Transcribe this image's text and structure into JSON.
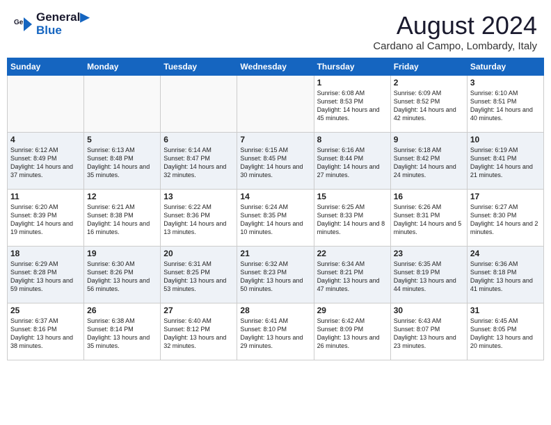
{
  "header": {
    "logo_line1": "General",
    "logo_line2": "Blue",
    "month_year": "August 2024",
    "location": "Cardano al Campo, Lombardy, Italy"
  },
  "weekdays": [
    "Sunday",
    "Monday",
    "Tuesday",
    "Wednesday",
    "Thursday",
    "Friday",
    "Saturday"
  ],
  "weeks": [
    [
      {
        "day": "",
        "content": ""
      },
      {
        "day": "",
        "content": ""
      },
      {
        "day": "",
        "content": ""
      },
      {
        "day": "",
        "content": ""
      },
      {
        "day": "1",
        "content": "Sunrise: 6:08 AM\nSunset: 8:53 PM\nDaylight: 14 hours and 45 minutes."
      },
      {
        "day": "2",
        "content": "Sunrise: 6:09 AM\nSunset: 8:52 PM\nDaylight: 14 hours and 42 minutes."
      },
      {
        "day": "3",
        "content": "Sunrise: 6:10 AM\nSunset: 8:51 PM\nDaylight: 14 hours and 40 minutes."
      }
    ],
    [
      {
        "day": "4",
        "content": "Sunrise: 6:12 AM\nSunset: 8:49 PM\nDaylight: 14 hours and 37 minutes."
      },
      {
        "day": "5",
        "content": "Sunrise: 6:13 AM\nSunset: 8:48 PM\nDaylight: 14 hours and 35 minutes."
      },
      {
        "day": "6",
        "content": "Sunrise: 6:14 AM\nSunset: 8:47 PM\nDaylight: 14 hours and 32 minutes."
      },
      {
        "day": "7",
        "content": "Sunrise: 6:15 AM\nSunset: 8:45 PM\nDaylight: 14 hours and 30 minutes."
      },
      {
        "day": "8",
        "content": "Sunrise: 6:16 AM\nSunset: 8:44 PM\nDaylight: 14 hours and 27 minutes."
      },
      {
        "day": "9",
        "content": "Sunrise: 6:18 AM\nSunset: 8:42 PM\nDaylight: 14 hours and 24 minutes."
      },
      {
        "day": "10",
        "content": "Sunrise: 6:19 AM\nSunset: 8:41 PM\nDaylight: 14 hours and 21 minutes."
      }
    ],
    [
      {
        "day": "11",
        "content": "Sunrise: 6:20 AM\nSunset: 8:39 PM\nDaylight: 14 hours and 19 minutes."
      },
      {
        "day": "12",
        "content": "Sunrise: 6:21 AM\nSunset: 8:38 PM\nDaylight: 14 hours and 16 minutes."
      },
      {
        "day": "13",
        "content": "Sunrise: 6:22 AM\nSunset: 8:36 PM\nDaylight: 14 hours and 13 minutes."
      },
      {
        "day": "14",
        "content": "Sunrise: 6:24 AM\nSunset: 8:35 PM\nDaylight: 14 hours and 10 minutes."
      },
      {
        "day": "15",
        "content": "Sunrise: 6:25 AM\nSunset: 8:33 PM\nDaylight: 14 hours and 8 minutes."
      },
      {
        "day": "16",
        "content": "Sunrise: 6:26 AM\nSunset: 8:31 PM\nDaylight: 14 hours and 5 minutes."
      },
      {
        "day": "17",
        "content": "Sunrise: 6:27 AM\nSunset: 8:30 PM\nDaylight: 14 hours and 2 minutes."
      }
    ],
    [
      {
        "day": "18",
        "content": "Sunrise: 6:29 AM\nSunset: 8:28 PM\nDaylight: 13 hours and 59 minutes."
      },
      {
        "day": "19",
        "content": "Sunrise: 6:30 AM\nSunset: 8:26 PM\nDaylight: 13 hours and 56 minutes."
      },
      {
        "day": "20",
        "content": "Sunrise: 6:31 AM\nSunset: 8:25 PM\nDaylight: 13 hours and 53 minutes."
      },
      {
        "day": "21",
        "content": "Sunrise: 6:32 AM\nSunset: 8:23 PM\nDaylight: 13 hours and 50 minutes."
      },
      {
        "day": "22",
        "content": "Sunrise: 6:34 AM\nSunset: 8:21 PM\nDaylight: 13 hours and 47 minutes."
      },
      {
        "day": "23",
        "content": "Sunrise: 6:35 AM\nSunset: 8:19 PM\nDaylight: 13 hours and 44 minutes."
      },
      {
        "day": "24",
        "content": "Sunrise: 6:36 AM\nSunset: 8:18 PM\nDaylight: 13 hours and 41 minutes."
      }
    ],
    [
      {
        "day": "25",
        "content": "Sunrise: 6:37 AM\nSunset: 8:16 PM\nDaylight: 13 hours and 38 minutes."
      },
      {
        "day": "26",
        "content": "Sunrise: 6:38 AM\nSunset: 8:14 PM\nDaylight: 13 hours and 35 minutes."
      },
      {
        "day": "27",
        "content": "Sunrise: 6:40 AM\nSunset: 8:12 PM\nDaylight: 13 hours and 32 minutes."
      },
      {
        "day": "28",
        "content": "Sunrise: 6:41 AM\nSunset: 8:10 PM\nDaylight: 13 hours and 29 minutes."
      },
      {
        "day": "29",
        "content": "Sunrise: 6:42 AM\nSunset: 8:09 PM\nDaylight: 13 hours and 26 minutes."
      },
      {
        "day": "30",
        "content": "Sunrise: 6:43 AM\nSunset: 8:07 PM\nDaylight: 13 hours and 23 minutes."
      },
      {
        "day": "31",
        "content": "Sunrise: 6:45 AM\nSunset: 8:05 PM\nDaylight: 13 hours and 20 minutes."
      }
    ]
  ]
}
